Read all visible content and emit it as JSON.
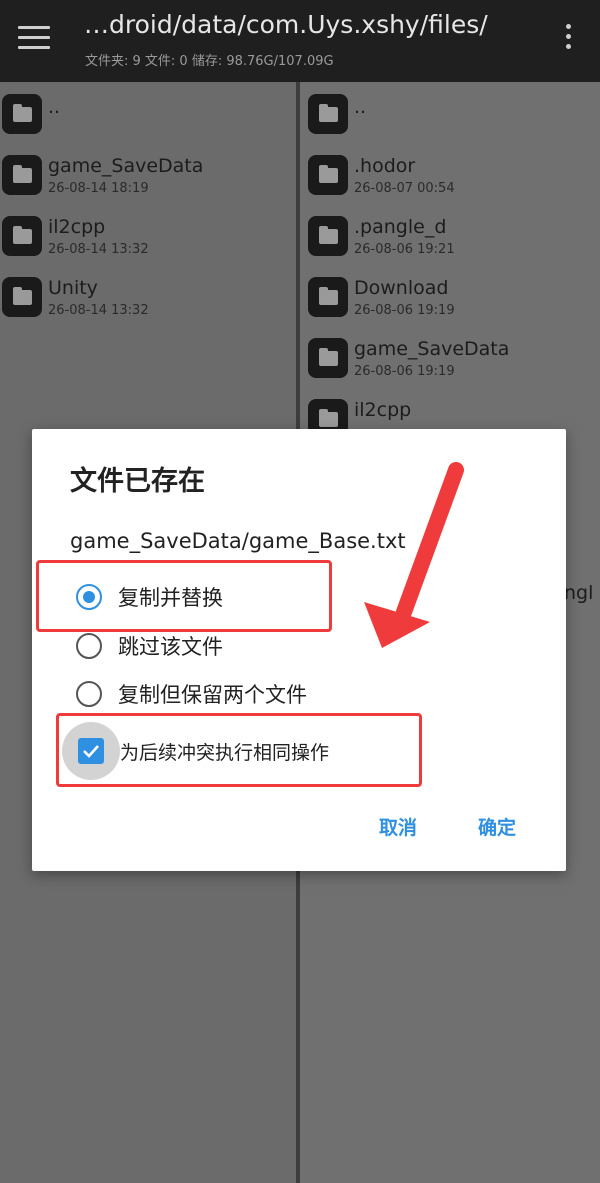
{
  "appbar": {
    "path": "…droid/data/com.Uys.xshy/files/",
    "stats": "文件夹: 9   文件: 0   储存: 98.76G/107.09G"
  },
  "left_pane": {
    "items": [
      {
        "name": "..",
        "date": ""
      },
      {
        "name": "game_SaveData",
        "date": "26-08-14 18:19"
      },
      {
        "name": "il2cpp",
        "date": "26-08-14 13:32"
      },
      {
        "name": "Unity",
        "date": "26-08-14 13:32"
      }
    ]
  },
  "right_pane": {
    "items": [
      {
        "name": "..",
        "date": ""
      },
      {
        "name": ".hodor",
        "date": "26-08-07 00:54"
      },
      {
        "name": ".pangle_d",
        "date": "26-08-06 19:21"
      },
      {
        "name": "Download",
        "date": "26-08-06 19:19"
      },
      {
        "name": "game_SaveData",
        "date": "26-08-06 19:19"
      },
      {
        "name": "il2cpp",
        "date": ""
      }
    ],
    "peek_text": "ngl"
  },
  "dialog": {
    "title": "文件已存在",
    "file_path": "game_SaveData/game_Base.txt",
    "options": [
      {
        "label": "复制并替换",
        "selected": true
      },
      {
        "label": "跳过该文件",
        "selected": false
      },
      {
        "label": "复制但保留两个文件",
        "selected": false
      }
    ],
    "apply_all": {
      "label": "为后续冲突执行相同操作",
      "checked": true
    },
    "cancel_label": "取消",
    "ok_label": "确定"
  },
  "colors": {
    "accent": "#2f8fe0",
    "annotation": "#ef3b3b",
    "appbar": "#1f1f1f"
  }
}
